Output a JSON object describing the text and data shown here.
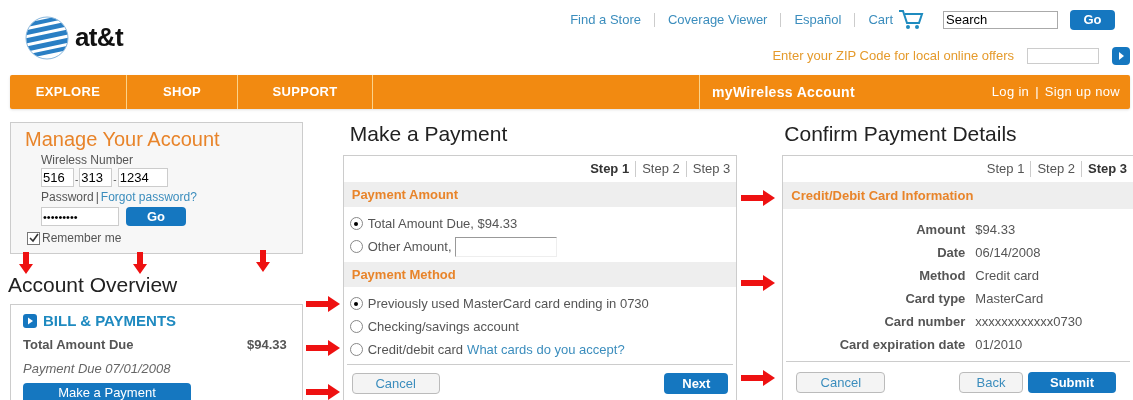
{
  "header": {
    "logo": "at&t",
    "top_links": [
      "Find a Store",
      "Coverage Viewer",
      "Español",
      "Cart"
    ],
    "search": {
      "value": "Search"
    },
    "search_button": "Go",
    "zip_prompt": "Enter your ZIP Code for local online offers"
  },
  "nav": {
    "items": [
      "EXPLORE",
      "SHOP",
      "SUPPORT"
    ],
    "account_label": "myWireless Account",
    "login": "Log in",
    "separator": "|",
    "signup": "Sign up now"
  },
  "manage": {
    "title": "Manage Your Account",
    "number_label": "Wireless Number",
    "number_parts": [
      "516",
      "313",
      "1234"
    ],
    "dash": "-",
    "password_label": "Password",
    "separator": "|",
    "forgot": "Forgot password?",
    "password": "•••••••••",
    "go": "Go",
    "remember": {
      "label": "Remember me",
      "checked": true
    }
  },
  "overview": {
    "title": "Account Overview",
    "section": "BILL & PAYMENTS",
    "total_label": "Total Amount Due",
    "total_value": "$94.33",
    "due": "Payment Due 07/01/2008",
    "button": "Make a Payment"
  },
  "payment": {
    "title": "Make a Payment",
    "steps": [
      {
        "label": "Step 1",
        "selected": true
      },
      {
        "label": "Step 2",
        "selected": false
      },
      {
        "label": "Step 3",
        "selected": false
      }
    ],
    "amount_heading": "Payment Amount",
    "amount_options": [
      {
        "kind": "plain",
        "label": "Total Amount Due, $94.33",
        "selected": true
      },
      {
        "kind": "field",
        "label": "Other Amount,",
        "selected": false
      }
    ],
    "method_heading": "Payment Method",
    "method_options": [
      {
        "kind": "plain",
        "label": "Previously used MasterCard card ending in 0730",
        "selected": true
      },
      {
        "kind": "plain",
        "label": "Checking/savings account",
        "selected": false
      },
      {
        "kind": "link",
        "label": "Credit/debit card",
        "link": "What cards do you accept?",
        "selected": false
      }
    ],
    "cancel": "Cancel",
    "next": "Next"
  },
  "confirm": {
    "title": "Confirm Payment Details",
    "steps": [
      {
        "label": "Step 1",
        "selected": false
      },
      {
        "label": "Step 2",
        "selected": false
      },
      {
        "label": "Step 3",
        "selected": true
      }
    ],
    "heading": "Credit/Debit Card Information",
    "details": [
      {
        "label": "Amount",
        "value": "$94.33"
      },
      {
        "label": "Date",
        "value": "06/14/2008"
      },
      {
        "label": "Method",
        "value": "Credit card"
      },
      {
        "label": "Card type",
        "value": "MasterCard"
      },
      {
        "label": "Card number",
        "value": "xxxxxxxxxxxx0730"
      },
      {
        "label": "Card expiration date",
        "value": "01/2010"
      }
    ],
    "cancel": "Cancel",
    "back": "Back",
    "submit": "Submit"
  }
}
